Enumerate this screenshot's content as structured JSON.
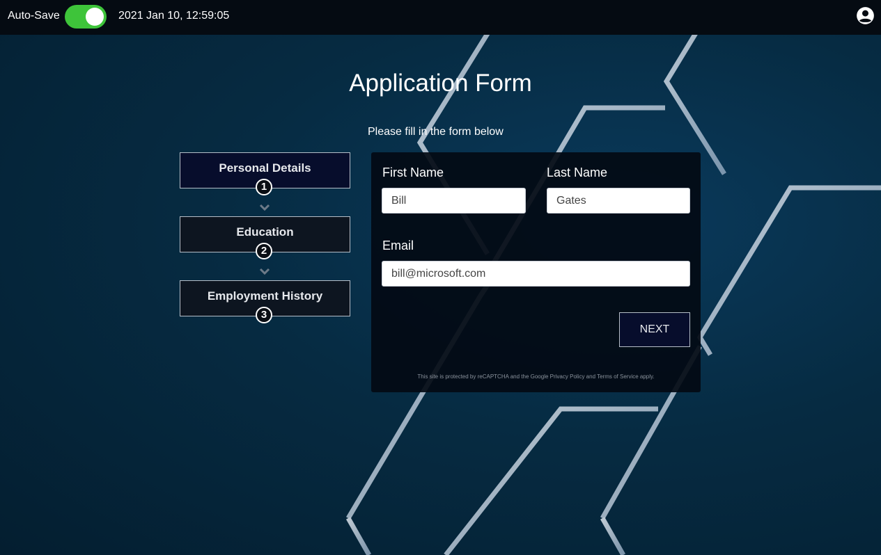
{
  "topbar": {
    "autosave_label": "Auto-Save",
    "autosave_on": true,
    "datetime": "2021 Jan 10, 12:59:05",
    "user_icon": "account-circle-icon"
  },
  "page": {
    "title": "Application Form",
    "subtitle": "Please fill in the form below"
  },
  "steps": [
    {
      "number": "1",
      "label": "Personal Details",
      "active": true
    },
    {
      "number": "2",
      "label": "Education",
      "active": false
    },
    {
      "number": "3",
      "label": "Employment History",
      "active": false
    }
  ],
  "form": {
    "first_name_label": "First Name",
    "first_name_value": "Bill",
    "last_name_label": "Last Name",
    "last_name_value": "Gates",
    "email_label": "Email",
    "email_value": "bill@microsoft.com",
    "next_label": "NEXT",
    "recaptcha_text": "This site is protected by reCAPTCHA and the Google Privacy Policy and Terms of Service apply."
  },
  "colors": {
    "toggle_on": "#3ec43a",
    "active_step_bg": "#070d2c",
    "background": "#062b42"
  }
}
